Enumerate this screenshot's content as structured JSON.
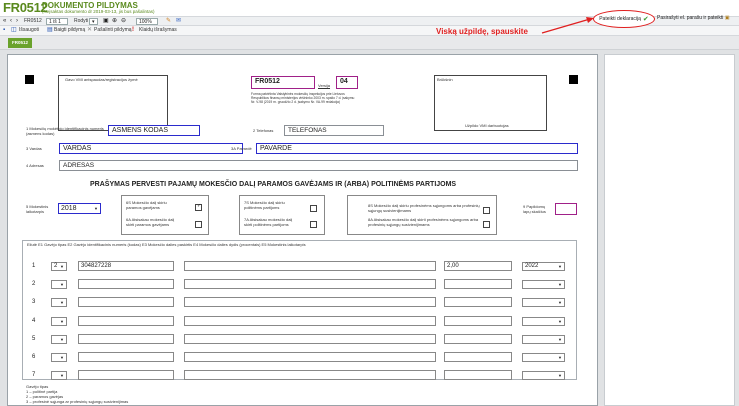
{
  "header": {
    "code": "FR0512",
    "title": "DOKUMENTO PILDYMAS",
    "subtitle": "(Neįsaktas dokumento dr 2019-03-13, jis bus pašalintas)"
  },
  "toolbar": {
    "form_name": "FR0512",
    "page_indicator": "1 iš 1",
    "view_label": "Rodyti",
    "zoom": "100%"
  },
  "toolbar2": {
    "save": "Išsaugoti",
    "close": "Baigti pildymą",
    "delete": "Pašalinti pildymą",
    "errors": "Klaidų išrašymas"
  },
  "tab": {
    "label": "FR0512"
  },
  "actions": {
    "submit": "Pateikti deklaraciją",
    "print": "Pasirašyti el. parašu ir pateikti"
  },
  "annotation": "Viską užpildę, spauskite",
  "form": {
    "stamp_left": "Gavo VMI antspaudas/registracijos žymė",
    "form_code": "FR0512",
    "version_label": "Versija",
    "version": "04",
    "form_desc": "Forma patvirtinta Valstybinės mokesčių inspekcijos prie Lietuvos Respublikos finansų ministerijos viršininko 2003 m. spalio 7 d. įsakymu Nr. V-98 (2019 m. gruodžio 2 d. įsakymo Nr. VA-99 redakcija)",
    "stamp_right_top": "Brūkšnin",
    "stamp_right_bot": "Užpildo VMI darbuotojas",
    "f1_label": "1 Mokesčių mokėtojo identifikacinis numeris (asmens kodas)",
    "f1_value": "ASMENS KODAS",
    "f2_label": "2 Telefonas",
    "f2_value": "TELEFONAS",
    "f3_label": "3 Vardas",
    "f3_value": "VARDAS",
    "f3a_label": "3A Pavardė",
    "f3a_value": "PAVARDE",
    "f4_label": "4 Adresas",
    "f4_value": "ADRESAS",
    "main_title": "PRAŠYMAS PERVESTI PAJAMŲ MOKESČIO DALĮ PARAMOS GAVĖJAMS IR (ARBA) POLITINĖMS PARTIJOMS",
    "f5_label": "5 Mokestinis laikotarpis",
    "f5_value": "2018",
    "g1a": "6S Mokesčio dalį skiriu paramos gavėjams",
    "g1b": "6A Atsisakau mokesčio dalį skirti paramos gavėjams",
    "g2a": "7S Mokesčio dalį skiriu politinėms partijoms",
    "g2b": "7A Atsisakau mokesčio dalį skirti politinėms partijoms",
    "g3a": "8S Mokesčio dalį skiriu profesinėms sąjungoms arba profesinių sąjungų susivienijimams",
    "g3b": "8A Atsisakau mokesčio dalį skirti profesinėms sąjungoms arba profesinių sąjungų susivienijimams",
    "f9_label": "9 Papildomų lapų skaičius",
    "cols_label": "Eilutė E1 Gavėjo tipas E2 Gavėjo identifikacinis numeris (kodas) E3 Mokesčio dalies paskirtis E4 Mokesčio dalies dydis (procentais) E5 Mokestinis laikotarpis",
    "rows": [
      {
        "n": "1",
        "type": "2",
        "code": "304827228",
        "pct": "2,00",
        "year": "2022"
      },
      {
        "n": "2",
        "type": "",
        "code": "",
        "pct": "",
        "year": ""
      },
      {
        "n": "3",
        "type": "",
        "code": "",
        "pct": "",
        "year": ""
      },
      {
        "n": "4",
        "type": "",
        "code": "",
        "pct": "",
        "year": ""
      },
      {
        "n": "5",
        "type": "",
        "code": "",
        "pct": "",
        "year": ""
      },
      {
        "n": "6",
        "type": "",
        "code": "",
        "pct": "",
        "year": ""
      },
      {
        "n": "7",
        "type": "",
        "code": "",
        "pct": "",
        "year": ""
      }
    ],
    "legend_title": "Gavėjo tipas",
    "legend_1": "1 – politinė partija",
    "legend_2": "2 – paramos gavėjas",
    "legend_3": "3 – profesinė sąjunga ar profesinių sąjungų susivienijimas"
  },
  "colors": {
    "brand": "#5a8a1e",
    "accent": "#e02020",
    "field_border": "#2b2bcc",
    "pink_border": "#a02088"
  }
}
